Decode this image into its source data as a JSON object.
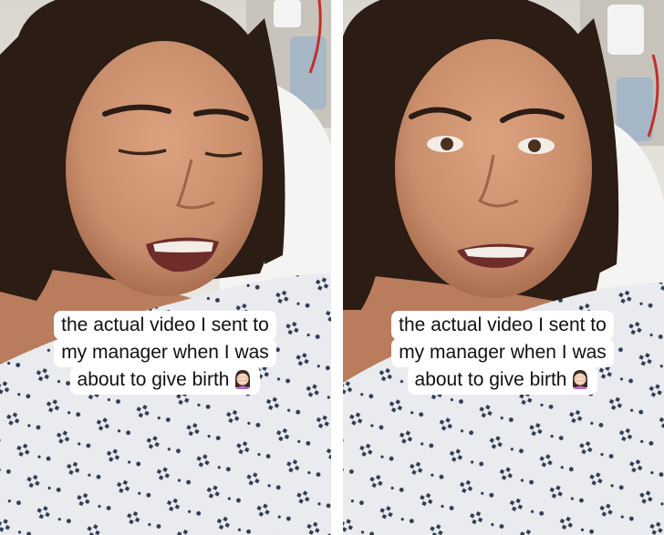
{
  "frames": [
    {
      "caption_lines": [
        "the actual  video I sent to",
        "my manager when I was",
        "about to give birth"
      ],
      "caption_emoji": "woman-facepalming-icon",
      "expression": "eyes-closed-smiling"
    },
    {
      "caption_lines": [
        "the actual  video I sent to",
        "my manager when I was",
        "about to give birth"
      ],
      "caption_emoji": "woman-facepalming-icon",
      "expression": "eyes-open-grimacing"
    }
  ],
  "colors": {
    "hair": "#2b1c14",
    "skin": "#c98e6c",
    "gown": "#e9ebee",
    "gown_pattern": "#2f3c52",
    "caption_bg": "#ffffff",
    "caption_text": "#111111"
  }
}
